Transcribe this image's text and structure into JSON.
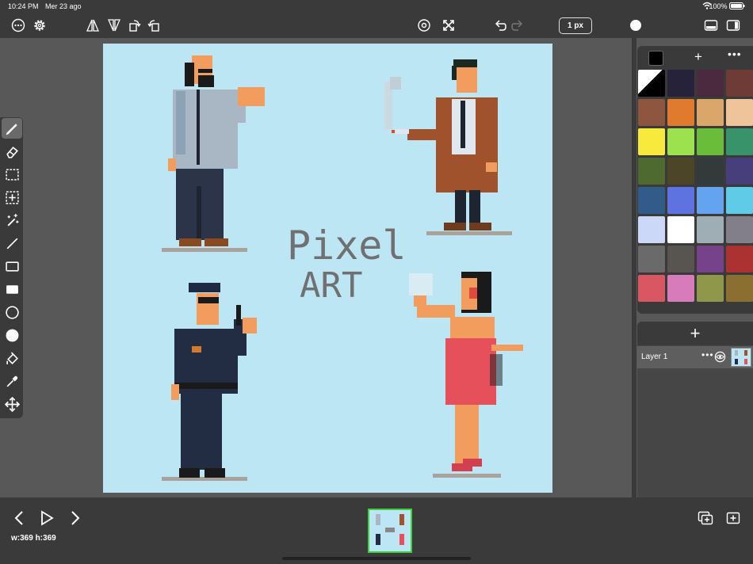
{
  "status": {
    "time": "10:24 PM",
    "date": "Mer 23 ago",
    "battery": "100%"
  },
  "toolbar": {
    "brush_size": "1 px"
  },
  "canvas": {
    "title_line1": "Pixel",
    "title_line2": "ART",
    "background": "#bde6f5"
  },
  "palette": {
    "current_color": "#000000",
    "colors": [
      "#000000",
      "#26223a",
      "#4b2a3f",
      "#6e3b36",
      "#8e563f",
      "#e07a2e",
      "#dba66a",
      "#f0c49a",
      "#f7ea3c",
      "#9be24e",
      "#6abd3a",
      "#38936a",
      "#4f6a30",
      "#4d4527",
      "#333a3a",
      "#463f7c",
      "#315b89",
      "#5f73e0",
      "#63a3f0",
      "#5fcbe6",
      "#ccd8f7",
      "#ffffff",
      "#9fadb5",
      "#837f8a",
      "#6a6a6a",
      "#585450",
      "#76428a",
      "#ac3232",
      "#d95763",
      "#d77bba",
      "#8f974a",
      "#8a6f30"
    ]
  },
  "layers": [
    {
      "name": "Layer 1"
    }
  ],
  "info": {
    "dims": "w:369 h:369"
  }
}
